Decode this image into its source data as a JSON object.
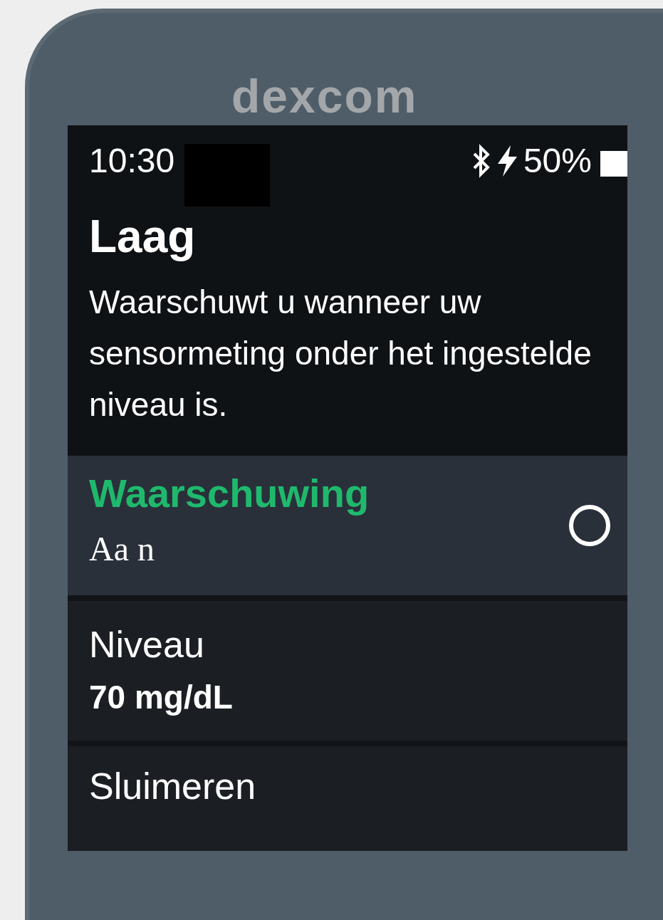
{
  "device": {
    "logo": "dexcom"
  },
  "status_bar": {
    "time": "10:30",
    "battery": "50%"
  },
  "screen": {
    "title": "Laag",
    "description": "Waarschuwt u wanneer uw sensormeting onder het ingestelde niveau is."
  },
  "settings": [
    {
      "kind": "toggle",
      "label": "Waarschuwing",
      "value": "Aa n",
      "selected": true,
      "checked": false
    },
    {
      "kind": "value",
      "label": "Niveau",
      "value": "70 mg/dL",
      "selected": false
    },
    {
      "kind": "link",
      "label": "Sluimeren",
      "selected": false
    }
  ]
}
